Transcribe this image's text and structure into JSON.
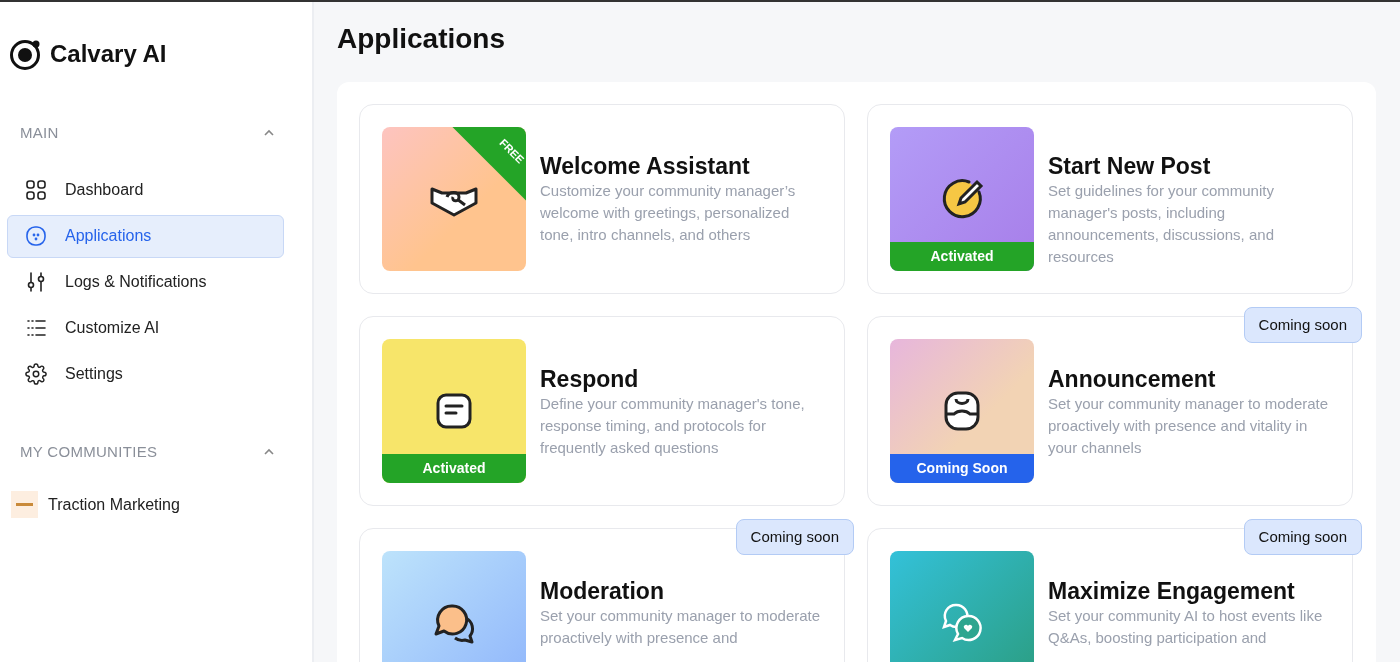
{
  "brand": {
    "name": "Calvary AI"
  },
  "sidebar": {
    "sections": [
      {
        "title": "MAIN",
        "expanded": true,
        "items": [
          {
            "label": "Dashboard",
            "selected": false
          },
          {
            "label": "Applications",
            "selected": true
          },
          {
            "label": "Logs & Notifications",
            "selected": false
          },
          {
            "label": "Customize AI",
            "selected": false
          },
          {
            "label": "Settings",
            "selected": false
          }
        ]
      },
      {
        "title": "MY COMMUNITIES",
        "expanded": true,
        "items": [
          {
            "label": "Traction Marketing",
            "selected": false
          }
        ]
      }
    ]
  },
  "page": {
    "title": "Applications"
  },
  "apps": [
    {
      "kind": "welcome",
      "title": "Welcome Assistant",
      "description": "Customize your community manager’s welcome with greetings, personalized tone, intro channels, and others",
      "tag": {
        "kind": "free",
        "label": "FREE"
      }
    },
    {
      "kind": "post",
      "title": "Start New Post",
      "description": "Set guidelines for your community manager's posts, including announcements, discussions, and resources",
      "tag": {
        "kind": "activated",
        "label": "Activated"
      }
    },
    {
      "kind": "respond",
      "title": "Respond",
      "description": "Define your community manager's tone, response timing, and protocols for frequently asked questions",
      "tag": {
        "kind": "activated",
        "label": "Activated"
      }
    },
    {
      "kind": "announce",
      "title": "Announcement",
      "description": "Set your community manager to moderate proactively with presence and vitality in your channels",
      "tag": {
        "kind": "coming_soon",
        "label": "Coming Soon"
      },
      "badge": "Coming soon"
    },
    {
      "kind": "moderate",
      "title": "Moderation",
      "description": "Set your community manager to moderate proactively with presence and",
      "badge": "Coming soon"
    },
    {
      "kind": "engage",
      "title": "Maximize Engagement",
      "description": "Set your community AI to host events like Q&As, boosting participation and",
      "badge": "Coming soon"
    }
  ]
}
